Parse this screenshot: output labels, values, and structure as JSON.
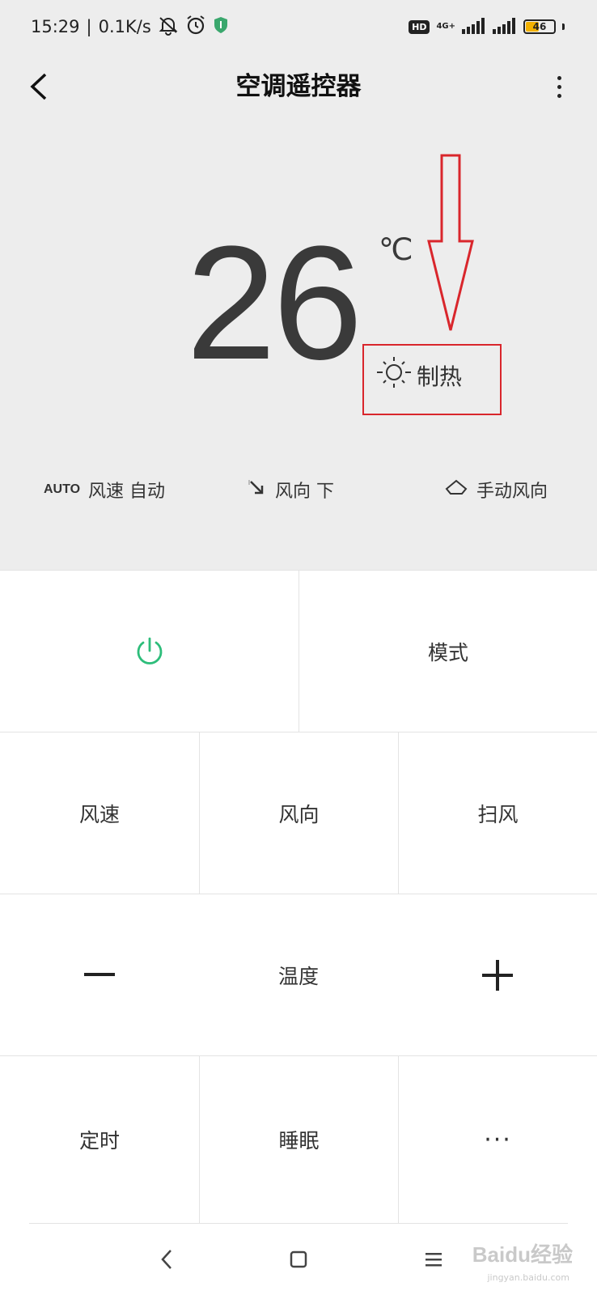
{
  "status_bar": {
    "time": "15:29",
    "separator": "|",
    "speed": "0.1K/s",
    "hd": "HD",
    "network": "4G+",
    "battery": "46",
    "battery_level": 0.46
  },
  "header": {
    "title": "空调遥控器"
  },
  "display": {
    "temperature": "26",
    "unit": "℃",
    "mode": "制热"
  },
  "status_row": {
    "wind_speed_auto": "AUTO",
    "wind_speed": "风速 自动",
    "wind_direction": "风向 下",
    "manual_direction": "手动风向"
  },
  "controls": {
    "mode": "模式",
    "wind_speed": "风速",
    "wind_direction": "风向",
    "swing": "扫风",
    "temperature": "温度",
    "timer": "定时",
    "sleep": "睡眠",
    "more": "···"
  },
  "watermark": {
    "text": "Baidu经验",
    "sub": "jingyan.baidu.com"
  },
  "colors": {
    "power": "#2dbd7a",
    "annotation": "#d9262c",
    "background": "#ededed"
  }
}
